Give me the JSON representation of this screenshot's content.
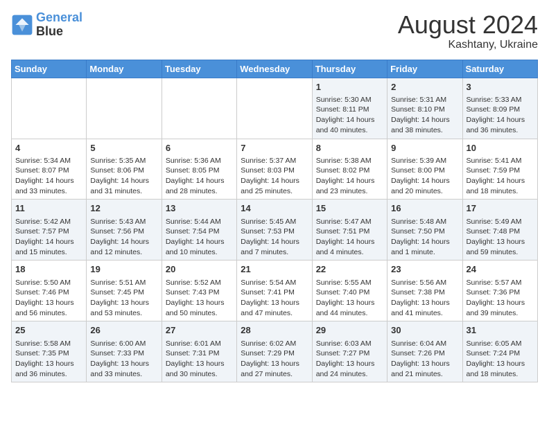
{
  "header": {
    "logo_line1": "General",
    "logo_line2": "Blue",
    "title": "August 2024",
    "subtitle": "Kashtany, Ukraine"
  },
  "days_of_week": [
    "Sunday",
    "Monday",
    "Tuesday",
    "Wednesday",
    "Thursday",
    "Friday",
    "Saturday"
  ],
  "weeks": [
    [
      {
        "day": "",
        "info": ""
      },
      {
        "day": "",
        "info": ""
      },
      {
        "day": "",
        "info": ""
      },
      {
        "day": "",
        "info": ""
      },
      {
        "day": "1",
        "info": "Sunrise: 5:30 AM\nSunset: 8:11 PM\nDaylight: 14 hours\nand 40 minutes."
      },
      {
        "day": "2",
        "info": "Sunrise: 5:31 AM\nSunset: 8:10 PM\nDaylight: 14 hours\nand 38 minutes."
      },
      {
        "day": "3",
        "info": "Sunrise: 5:33 AM\nSunset: 8:09 PM\nDaylight: 14 hours\nand 36 minutes."
      }
    ],
    [
      {
        "day": "4",
        "info": "Sunrise: 5:34 AM\nSunset: 8:07 PM\nDaylight: 14 hours\nand 33 minutes."
      },
      {
        "day": "5",
        "info": "Sunrise: 5:35 AM\nSunset: 8:06 PM\nDaylight: 14 hours\nand 31 minutes."
      },
      {
        "day": "6",
        "info": "Sunrise: 5:36 AM\nSunset: 8:05 PM\nDaylight: 14 hours\nand 28 minutes."
      },
      {
        "day": "7",
        "info": "Sunrise: 5:37 AM\nSunset: 8:03 PM\nDaylight: 14 hours\nand 25 minutes."
      },
      {
        "day": "8",
        "info": "Sunrise: 5:38 AM\nSunset: 8:02 PM\nDaylight: 14 hours\nand 23 minutes."
      },
      {
        "day": "9",
        "info": "Sunrise: 5:39 AM\nSunset: 8:00 PM\nDaylight: 14 hours\nand 20 minutes."
      },
      {
        "day": "10",
        "info": "Sunrise: 5:41 AM\nSunset: 7:59 PM\nDaylight: 14 hours\nand 18 minutes."
      }
    ],
    [
      {
        "day": "11",
        "info": "Sunrise: 5:42 AM\nSunset: 7:57 PM\nDaylight: 14 hours\nand 15 minutes."
      },
      {
        "day": "12",
        "info": "Sunrise: 5:43 AM\nSunset: 7:56 PM\nDaylight: 14 hours\nand 12 minutes."
      },
      {
        "day": "13",
        "info": "Sunrise: 5:44 AM\nSunset: 7:54 PM\nDaylight: 14 hours\nand 10 minutes."
      },
      {
        "day": "14",
        "info": "Sunrise: 5:45 AM\nSunset: 7:53 PM\nDaylight: 14 hours\nand 7 minutes."
      },
      {
        "day": "15",
        "info": "Sunrise: 5:47 AM\nSunset: 7:51 PM\nDaylight: 14 hours\nand 4 minutes."
      },
      {
        "day": "16",
        "info": "Sunrise: 5:48 AM\nSunset: 7:50 PM\nDaylight: 14 hours\nand 1 minute."
      },
      {
        "day": "17",
        "info": "Sunrise: 5:49 AM\nSunset: 7:48 PM\nDaylight: 13 hours\nand 59 minutes."
      }
    ],
    [
      {
        "day": "18",
        "info": "Sunrise: 5:50 AM\nSunset: 7:46 PM\nDaylight: 13 hours\nand 56 minutes."
      },
      {
        "day": "19",
        "info": "Sunrise: 5:51 AM\nSunset: 7:45 PM\nDaylight: 13 hours\nand 53 minutes."
      },
      {
        "day": "20",
        "info": "Sunrise: 5:52 AM\nSunset: 7:43 PM\nDaylight: 13 hours\nand 50 minutes."
      },
      {
        "day": "21",
        "info": "Sunrise: 5:54 AM\nSunset: 7:41 PM\nDaylight: 13 hours\nand 47 minutes."
      },
      {
        "day": "22",
        "info": "Sunrise: 5:55 AM\nSunset: 7:40 PM\nDaylight: 13 hours\nand 44 minutes."
      },
      {
        "day": "23",
        "info": "Sunrise: 5:56 AM\nSunset: 7:38 PM\nDaylight: 13 hours\nand 41 minutes."
      },
      {
        "day": "24",
        "info": "Sunrise: 5:57 AM\nSunset: 7:36 PM\nDaylight: 13 hours\nand 39 minutes."
      }
    ],
    [
      {
        "day": "25",
        "info": "Sunrise: 5:58 AM\nSunset: 7:35 PM\nDaylight: 13 hours\nand 36 minutes."
      },
      {
        "day": "26",
        "info": "Sunrise: 6:00 AM\nSunset: 7:33 PM\nDaylight: 13 hours\nand 33 minutes."
      },
      {
        "day": "27",
        "info": "Sunrise: 6:01 AM\nSunset: 7:31 PM\nDaylight: 13 hours\nand 30 minutes."
      },
      {
        "day": "28",
        "info": "Sunrise: 6:02 AM\nSunset: 7:29 PM\nDaylight: 13 hours\nand 27 minutes."
      },
      {
        "day": "29",
        "info": "Sunrise: 6:03 AM\nSunset: 7:27 PM\nDaylight: 13 hours\nand 24 minutes."
      },
      {
        "day": "30",
        "info": "Sunrise: 6:04 AM\nSunset: 7:26 PM\nDaylight: 13 hours\nand 21 minutes."
      },
      {
        "day": "31",
        "info": "Sunrise: 6:05 AM\nSunset: 7:24 PM\nDaylight: 13 hours\nand 18 minutes."
      }
    ]
  ]
}
